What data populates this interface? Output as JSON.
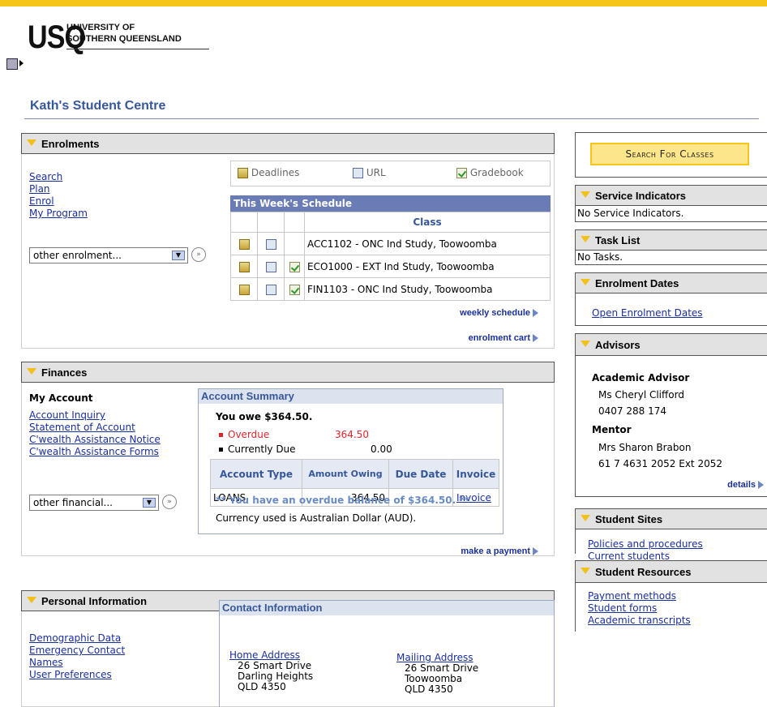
{
  "header": {
    "logo": "USQ",
    "university_line1": "UNIVERSITY OF",
    "university_line2": "SOUTHERN QUEENSLAND"
  },
  "page_title": "Kath's Student Centre",
  "enrolments": {
    "title": "Enrolments",
    "links": [
      "Search",
      "Plan",
      "Enrol",
      "My Program"
    ],
    "select_value": "other enrolment...",
    "tabs": {
      "deadlines": "Deadlines",
      "url": "URL",
      "gradebook": "Gradebook"
    },
    "schedule_title": "This Week's Schedule",
    "class_header": "Class",
    "classes": [
      "ACC1102 - ONC Ind Study, Toowoomba",
      "ECO1000 - EXT Ind Study, Toowoomba",
      "FIN1103 - ONC Ind Study, Toowoomba"
    ],
    "weekly_schedule": "weekly schedule",
    "enrolment_cart": "enrolment cart"
  },
  "finances": {
    "title": "Finances",
    "my_account": "My Account",
    "links": [
      "Account Inquiry",
      "Statement of Account",
      "C'wealth Assistance Notice",
      "C'wealth Assistance Forms"
    ],
    "select_value": "other financial...",
    "summary_title": "Account Summary",
    "you_owe": "You owe $364.50.",
    "overdue_label": "Overdue",
    "overdue_value": "364.50",
    "current_label": "Currently Due",
    "current_value": "0.00",
    "table_headers": [
      "Account Type",
      "Amount Owing",
      "Due Date",
      "Invoice"
    ],
    "row": {
      "type": "LOANS",
      "amount": "364.50",
      "due": "",
      "invoice": "Invoice"
    },
    "overdue_note": "** You have an overdue balance of $364.50. **",
    "currency_note": "Currency used is Australian Dollar (AUD).",
    "make_payment": "make a payment"
  },
  "personal": {
    "title": "Personal Information",
    "links": [
      "Demographic Data",
      "Emergency Contact",
      "Names",
      "User Preferences"
    ],
    "contact_title": "Contact Information",
    "home_label": "Home Address",
    "home_lines": [
      "26 Smart Drive",
      "Darling Heights",
      "QLD 4350"
    ],
    "mailing_label": "Mailing Address",
    "mailing_lines": [
      "26 Smart Drive",
      "Toowoomba",
      "QLD 4350"
    ]
  },
  "sidebar": {
    "search_button": "Search For Classes",
    "service_title": "Service Indicators",
    "service_text": "No Service Indicators.",
    "task_title": "Task List",
    "task_text": "No Tasks.",
    "enrol_dates_title": "Enrolment Dates",
    "enrol_dates_link": "Open Enrolment Dates",
    "advisors_title": "Advisors",
    "academic_advisor_label": "Academic Advisor",
    "academic_advisor_name": "Ms Cheryl Clifford",
    "academic_advisor_phone": "0407 288 174",
    "mentor_label": "Mentor",
    "mentor_name": "Mrs Sharon Brabon",
    "mentor_phone": "61 7 4631 2052 Ext 2052",
    "details": "details",
    "sites_title": "Student Sites",
    "sites_links": [
      "Policies and procedures",
      "Current students"
    ],
    "resources_title": "Student Resources",
    "resources_links": [
      "Payment methods",
      "Student forms",
      "Academic transcripts"
    ]
  },
  "colors": {
    "accent": "#f5c518",
    "link": "#1a2f9e",
    "title": "#37579b",
    "overdue": "#e0262b"
  }
}
